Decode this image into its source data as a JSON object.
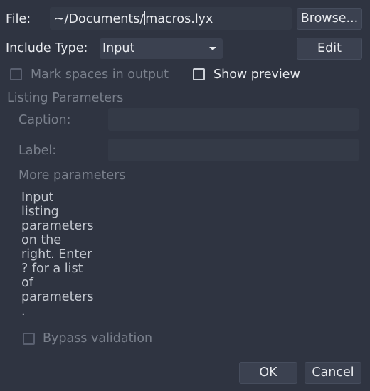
{
  "file": {
    "label": "File:",
    "value_before_cursor": "~/Documents/",
    "value_after_cursor": "macros.lyx",
    "browse_label": "Browse..."
  },
  "include_type": {
    "label": "Include Type:",
    "selected": "Input",
    "edit_label": "Edit"
  },
  "options": {
    "mark_spaces_label": "Mark spaces in output",
    "show_preview_label": "Show preview"
  },
  "listing": {
    "section_label": "Listing Parameters",
    "caption_label": "Caption:",
    "caption_value": "",
    "label_label": "Label:",
    "label_value": "",
    "more_params_label": "More parameters",
    "help_text": "Input\nlisting\nparameters\non the\nright. Enter\n? for a list\nof\nparameters\n.",
    "bypass_label": "Bypass validation"
  },
  "dialog": {
    "ok_label": "OK",
    "cancel_label": "Cancel"
  },
  "colors": {
    "background": "#2f3441",
    "field": "#343a47",
    "text": "#e8eaee",
    "disabled_text": "#7a808c"
  }
}
